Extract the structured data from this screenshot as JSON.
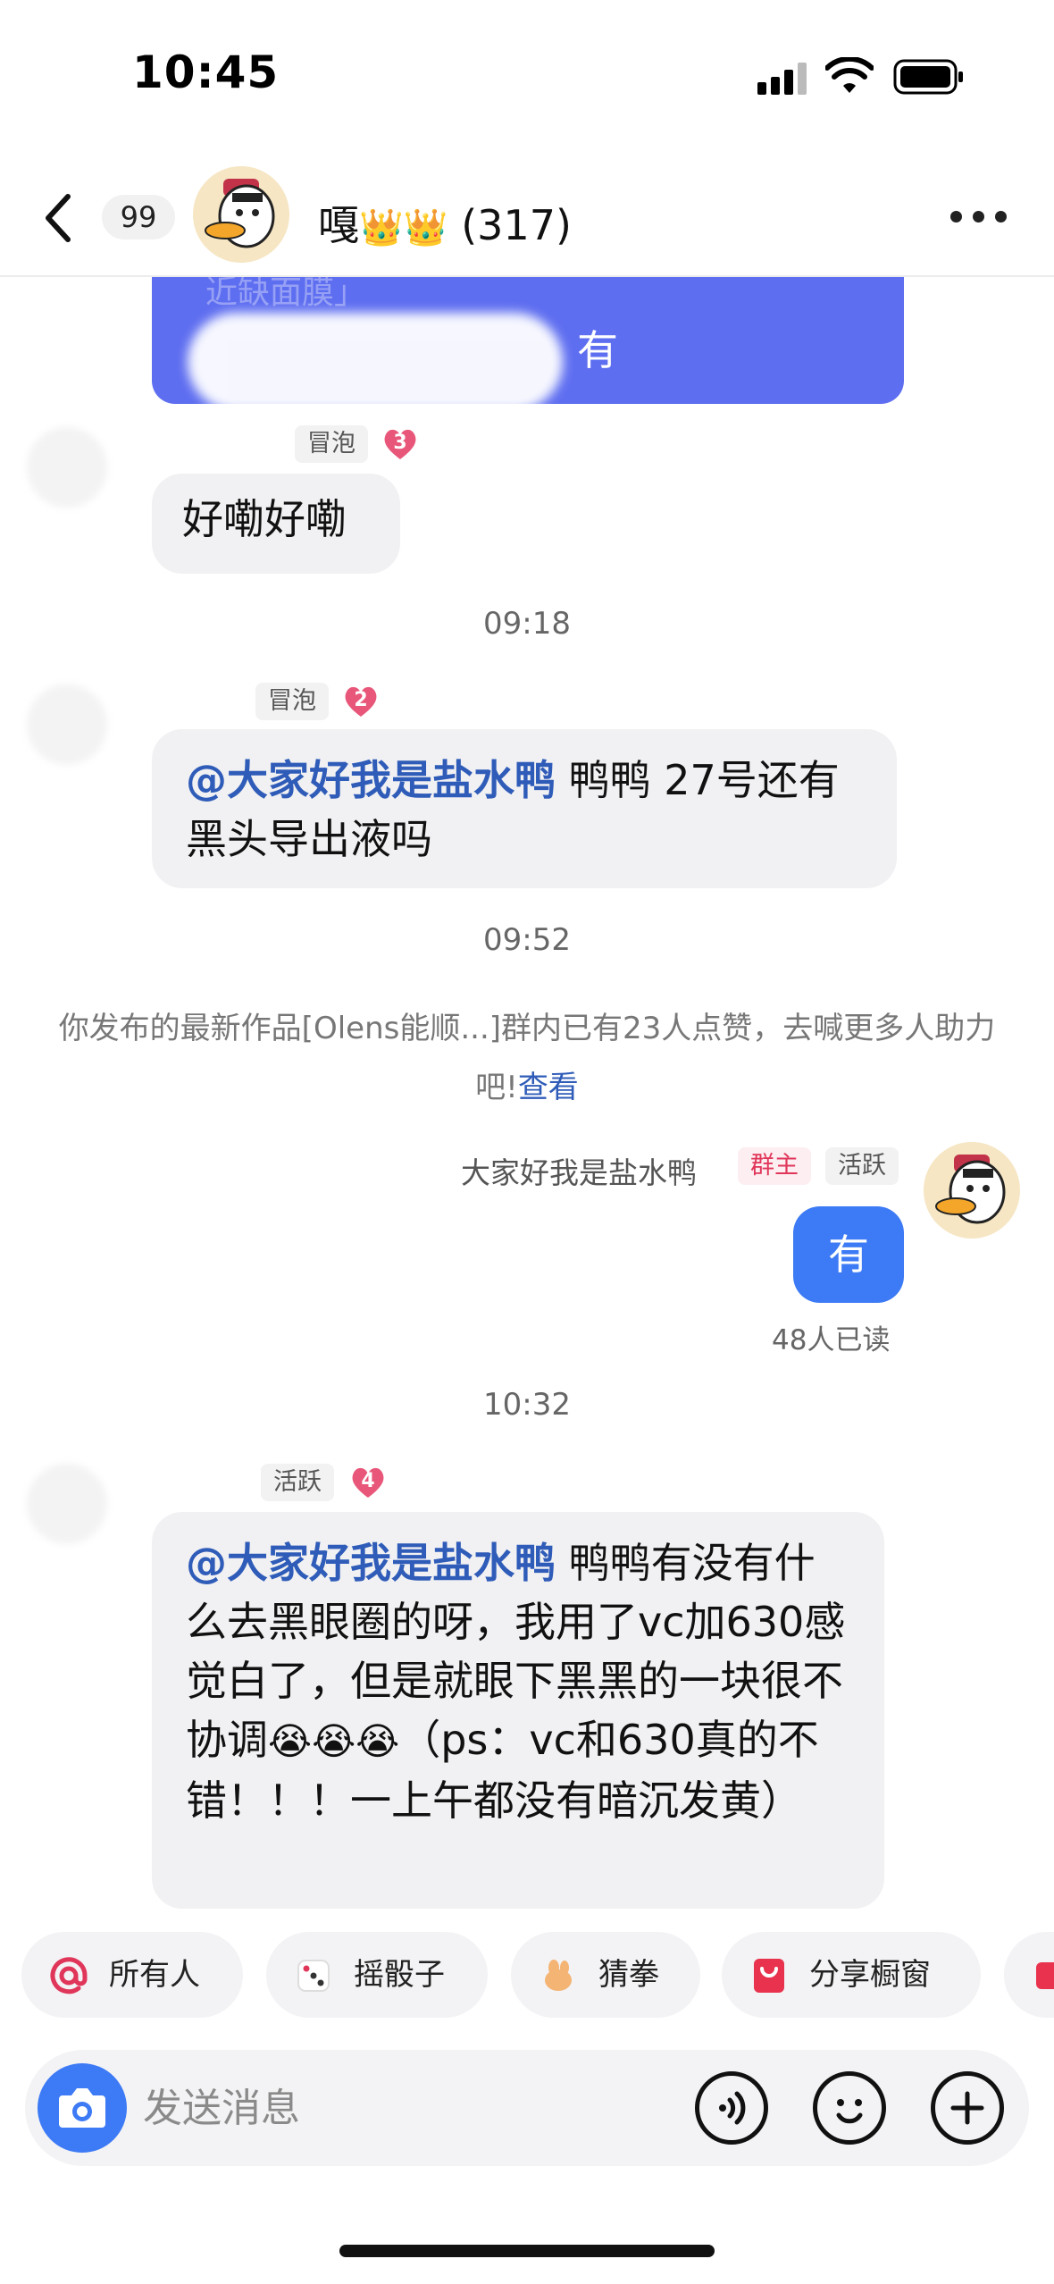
{
  "status_bar": {
    "time": "10:45"
  },
  "header": {
    "unread_count": "99",
    "title": "嘎",
    "crowns": "👑👑",
    "member_count": "(317)"
  },
  "messages": {
    "purple_card": {
      "faded_text": "近缺面膜」",
      "text": "有"
    },
    "msg1": {
      "tag": "冒泡",
      "level": "3",
      "text": "好嘞好嘞"
    },
    "time1": "09:18",
    "msg2": {
      "tag": "冒泡",
      "level": "2",
      "mention": "@大家好我是盐水鸭",
      "text": " 鸭鸭 27号还有黑头导出液吗"
    },
    "time2": "09:52",
    "system_notice": {
      "text": "你发布的最新作品[Olens能顺...]群内已有23人点赞，去喊更多人助力吧!",
      "link": "查看"
    },
    "my_msg": {
      "sender": "大家好我是盐水鸭",
      "owner_tag": "群主",
      "active_tag": "活跃",
      "text": "有",
      "read_status": "48人已读"
    },
    "time3": "10:32",
    "msg3": {
      "tag": "活跃",
      "level": "4",
      "mention": "@大家好我是盐水鸭",
      "text": " 鸭鸭有没有什么去黑眼圈的呀，我用了vc加630感觉白了，但是就眼下黑黑的一块很不协调",
      "emojis": "😭😭😭",
      "text2": "（ps：vc和630真的不错！！！一上午都没有暗沉发黄）"
    }
  },
  "quick_actions": [
    {
      "label": "所有人",
      "icon": "at-icon"
    },
    {
      "label": "摇骰子",
      "icon": "dice-icon"
    },
    {
      "label": "猜拳",
      "icon": "rock-paper-scissors-icon"
    },
    {
      "label": "分享橱窗",
      "icon": "showcase-icon"
    }
  ],
  "input": {
    "placeholder": "发送消息"
  },
  "colors": {
    "accent_blue": "#3d7af5",
    "card_purple": "#5e6ef0",
    "mention_blue": "#2f5cb8",
    "owner_red": "#e0365a"
  }
}
